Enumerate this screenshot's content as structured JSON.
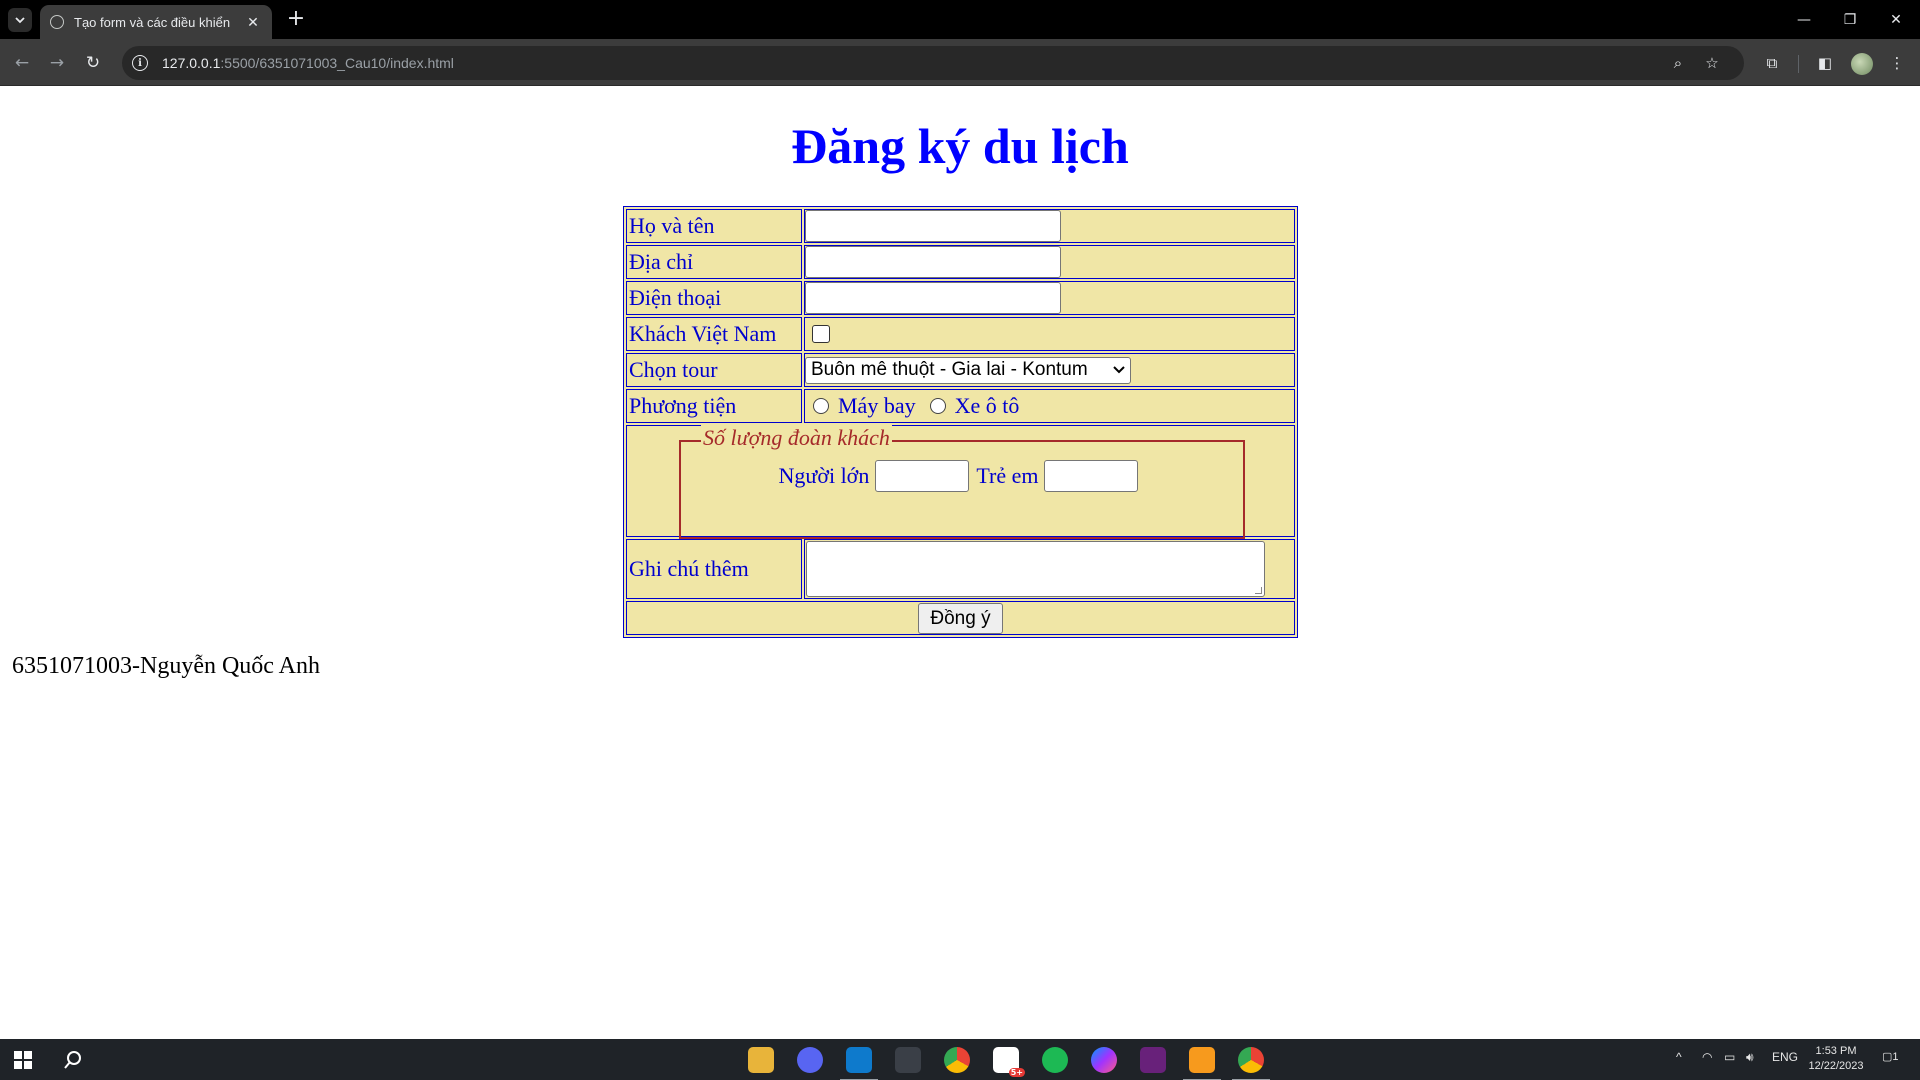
{
  "browser": {
    "tab_title": "Tạo form và các điều khiển",
    "tab_close": "✕",
    "new_tab": "+",
    "url_host": "127.0.0.1",
    "url_rest": ":5500/6351071003_Cau10/index.html",
    "icons": [
      "tab-list-icon",
      "back-icon",
      "forward-icon",
      "reload-icon",
      "site-info-icon",
      "zoom-icon",
      "bookmark-star-icon",
      "extensions-icon",
      "side-panel-icon",
      "profile-avatar",
      "menu-icon",
      "minimize-icon",
      "restore-icon",
      "close-icon"
    ]
  },
  "page": {
    "heading": "Đăng ký du lịch",
    "form": {
      "name_label": "Họ và tên",
      "name_value": "",
      "address_label": "Địa chỉ",
      "address_value": "",
      "phone_label": "Điện thoại",
      "phone_value": "",
      "vietnamese_label": "Khách Việt Nam",
      "vietnamese_checked": false,
      "tour_label": "Chọn tour",
      "tour_selected": "Buôn mê thuột - Gia lai - Kontum",
      "transport_label": "Phương tiện",
      "transport_options": [
        "Máy bay",
        "Xe ô tô"
      ],
      "transport_selected": null,
      "group_legend": "Số lượng đoàn khách",
      "adults_label": "Người lớn",
      "adults_value": "",
      "children_label": "Trẻ em",
      "children_value": "",
      "notes_label": "Ghi chú thêm",
      "notes_value": "",
      "submit_label": "Đồng ý"
    },
    "footer": "6351071003-Nguyễn Quốc Anh",
    "colors": {
      "heading": "#0000ff",
      "labels": "#0000cd",
      "table_bg": "#f0e6a6",
      "fieldset_border": "#a52a2a"
    }
  },
  "taskbar": {
    "apps": [
      "windows-start-icon",
      "search-icon",
      "file-explorer-icon",
      "discord-icon",
      "vscode-icon",
      "app-icon",
      "chrome-icon",
      "zalo-icon",
      "spotify-icon",
      "messenger-icon",
      "visual-studio-icon",
      "sublime-icon",
      "chrome-active-icon"
    ],
    "zalo_badge": "5+",
    "language": "ENG",
    "time": "1:53 PM",
    "date": "12/22/2023",
    "notification_count": "1"
  }
}
